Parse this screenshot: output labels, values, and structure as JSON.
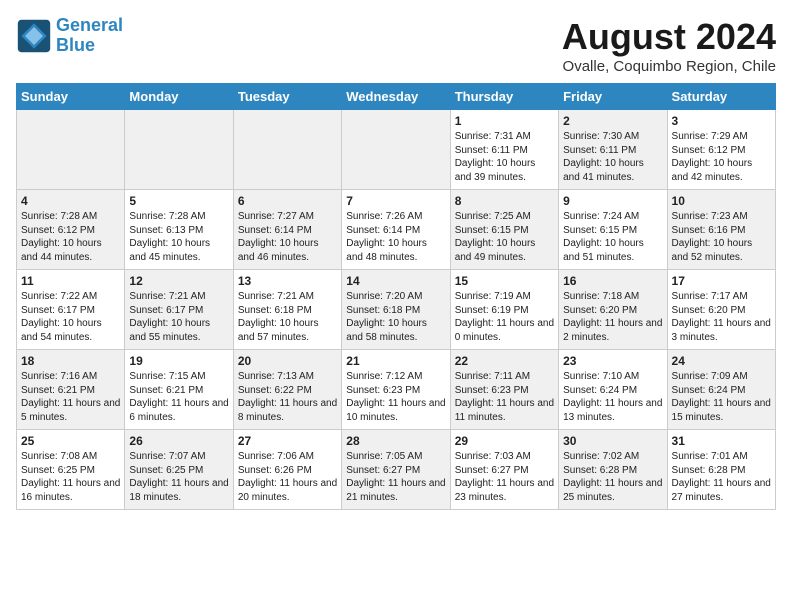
{
  "header": {
    "logo_line1": "General",
    "logo_line2": "Blue",
    "month_title": "August 2024",
    "subtitle": "Ovalle, Coquimbo Region, Chile"
  },
  "days_of_week": [
    "Sunday",
    "Monday",
    "Tuesday",
    "Wednesday",
    "Thursday",
    "Friday",
    "Saturday"
  ],
  "weeks": [
    [
      {
        "day": "",
        "info": "",
        "shaded": true
      },
      {
        "day": "",
        "info": "",
        "shaded": true
      },
      {
        "day": "",
        "info": "",
        "shaded": true
      },
      {
        "day": "",
        "info": "",
        "shaded": true
      },
      {
        "day": "1",
        "info": "Sunrise: 7:31 AM\nSunset: 6:11 PM\nDaylight: 10 hours and 39 minutes."
      },
      {
        "day": "2",
        "info": "Sunrise: 7:30 AM\nSunset: 6:11 PM\nDaylight: 10 hours and 41 minutes.",
        "shaded": true
      },
      {
        "day": "3",
        "info": "Sunrise: 7:29 AM\nSunset: 6:12 PM\nDaylight: 10 hours and 42 minutes."
      }
    ],
    [
      {
        "day": "4",
        "info": "Sunrise: 7:28 AM\nSunset: 6:12 PM\nDaylight: 10 hours and 44 minutes.",
        "shaded": true
      },
      {
        "day": "5",
        "info": "Sunrise: 7:28 AM\nSunset: 6:13 PM\nDaylight: 10 hours and 45 minutes."
      },
      {
        "day": "6",
        "info": "Sunrise: 7:27 AM\nSunset: 6:14 PM\nDaylight: 10 hours and 46 minutes.",
        "shaded": true
      },
      {
        "day": "7",
        "info": "Sunrise: 7:26 AM\nSunset: 6:14 PM\nDaylight: 10 hours and 48 minutes."
      },
      {
        "day": "8",
        "info": "Sunrise: 7:25 AM\nSunset: 6:15 PM\nDaylight: 10 hours and 49 minutes.",
        "shaded": true
      },
      {
        "day": "9",
        "info": "Sunrise: 7:24 AM\nSunset: 6:15 PM\nDaylight: 10 hours and 51 minutes."
      },
      {
        "day": "10",
        "info": "Sunrise: 7:23 AM\nSunset: 6:16 PM\nDaylight: 10 hours and 52 minutes.",
        "shaded": true
      }
    ],
    [
      {
        "day": "11",
        "info": "Sunrise: 7:22 AM\nSunset: 6:17 PM\nDaylight: 10 hours and 54 minutes."
      },
      {
        "day": "12",
        "info": "Sunrise: 7:21 AM\nSunset: 6:17 PM\nDaylight: 10 hours and 55 minutes.",
        "shaded": true
      },
      {
        "day": "13",
        "info": "Sunrise: 7:21 AM\nSunset: 6:18 PM\nDaylight: 10 hours and 57 minutes."
      },
      {
        "day": "14",
        "info": "Sunrise: 7:20 AM\nSunset: 6:18 PM\nDaylight: 10 hours and 58 minutes.",
        "shaded": true
      },
      {
        "day": "15",
        "info": "Sunrise: 7:19 AM\nSunset: 6:19 PM\nDaylight: 11 hours and 0 minutes."
      },
      {
        "day": "16",
        "info": "Sunrise: 7:18 AM\nSunset: 6:20 PM\nDaylight: 11 hours and 2 minutes.",
        "shaded": true
      },
      {
        "day": "17",
        "info": "Sunrise: 7:17 AM\nSunset: 6:20 PM\nDaylight: 11 hours and 3 minutes."
      }
    ],
    [
      {
        "day": "18",
        "info": "Sunrise: 7:16 AM\nSunset: 6:21 PM\nDaylight: 11 hours and 5 minutes.",
        "shaded": true
      },
      {
        "day": "19",
        "info": "Sunrise: 7:15 AM\nSunset: 6:21 PM\nDaylight: 11 hours and 6 minutes."
      },
      {
        "day": "20",
        "info": "Sunrise: 7:13 AM\nSunset: 6:22 PM\nDaylight: 11 hours and 8 minutes.",
        "shaded": true
      },
      {
        "day": "21",
        "info": "Sunrise: 7:12 AM\nSunset: 6:23 PM\nDaylight: 11 hours and 10 minutes."
      },
      {
        "day": "22",
        "info": "Sunrise: 7:11 AM\nSunset: 6:23 PM\nDaylight: 11 hours and 11 minutes.",
        "shaded": true
      },
      {
        "day": "23",
        "info": "Sunrise: 7:10 AM\nSunset: 6:24 PM\nDaylight: 11 hours and 13 minutes."
      },
      {
        "day": "24",
        "info": "Sunrise: 7:09 AM\nSunset: 6:24 PM\nDaylight: 11 hours and 15 minutes.",
        "shaded": true
      }
    ],
    [
      {
        "day": "25",
        "info": "Sunrise: 7:08 AM\nSunset: 6:25 PM\nDaylight: 11 hours and 16 minutes."
      },
      {
        "day": "26",
        "info": "Sunrise: 7:07 AM\nSunset: 6:25 PM\nDaylight: 11 hours and 18 minutes.",
        "shaded": true
      },
      {
        "day": "27",
        "info": "Sunrise: 7:06 AM\nSunset: 6:26 PM\nDaylight: 11 hours and 20 minutes."
      },
      {
        "day": "28",
        "info": "Sunrise: 7:05 AM\nSunset: 6:27 PM\nDaylight: 11 hours and 21 minutes.",
        "shaded": true
      },
      {
        "day": "29",
        "info": "Sunrise: 7:03 AM\nSunset: 6:27 PM\nDaylight: 11 hours and 23 minutes."
      },
      {
        "day": "30",
        "info": "Sunrise: 7:02 AM\nSunset: 6:28 PM\nDaylight: 11 hours and 25 minutes.",
        "shaded": true
      },
      {
        "day": "31",
        "info": "Sunrise: 7:01 AM\nSunset: 6:28 PM\nDaylight: 11 hours and 27 minutes."
      }
    ]
  ]
}
